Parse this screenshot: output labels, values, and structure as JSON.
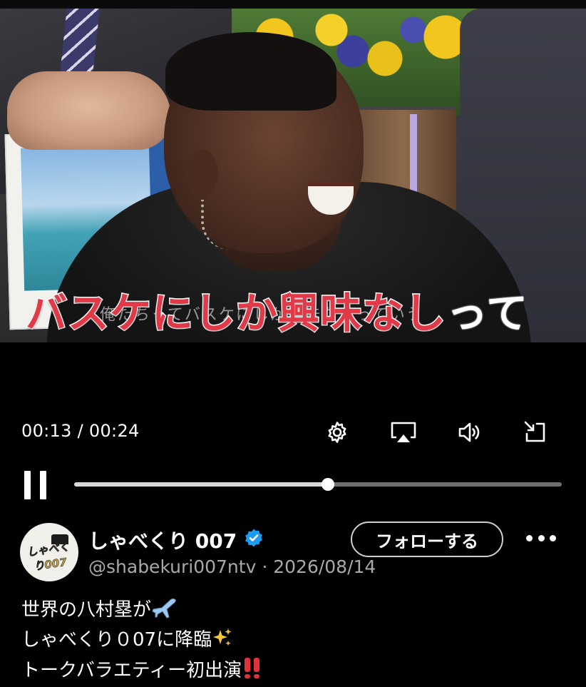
{
  "video": {
    "caption": "バスケにしか興味なし",
    "caption_tail": "って",
    "faint_subtitle": "俺たちってバスケにしか興味ないっていう",
    "caption_color": "#e03a48"
  },
  "player": {
    "current_time": "00:13",
    "separator": " / ",
    "duration": "00:24",
    "progress_fraction": 0.52,
    "icons": [
      "settings-gear-icon",
      "airplay-icon",
      "volume-icon",
      "exit-fullscreen-icon",
      "pause-icon"
    ]
  },
  "post": {
    "display_name": "しゃべくり 007",
    "verified": true,
    "verified_color": "#1d9bf0",
    "handle": "@shabekuri007ntv",
    "dot": " · ",
    "date": "2026/08/14",
    "follow_label": "フォローする",
    "avatar_text": "しゃべくり007",
    "lines": [
      {
        "text": "世界の八村塁が",
        "emoji": "airplane-emoji"
      },
      {
        "text": "しゃべくり０07に降臨",
        "emoji": "sparkles-emoji"
      },
      {
        "text": "トークバラエティー初出演",
        "emoji": "double-exclamation-emoji"
      }
    ]
  }
}
